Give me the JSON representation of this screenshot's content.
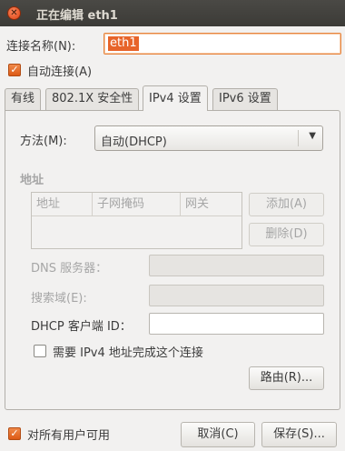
{
  "window": {
    "title": "正在编辑 eth1",
    "close_glyph": "✕"
  },
  "connection_name": {
    "label": "连接名称(N):",
    "value": "eth1"
  },
  "auto_connect": {
    "label": "自动连接(A)",
    "checked": true
  },
  "tabs": [
    {
      "label": "有线",
      "active": false
    },
    {
      "label": "802.1X 安全性",
      "active": false
    },
    {
      "label": "IPv4 设置",
      "active": true
    },
    {
      "label": "IPv6 设置",
      "active": false
    }
  ],
  "ipv4": {
    "method_label": "方法(M):",
    "method_value": "自动(DHCP)",
    "address_section": "地址",
    "table_headers": [
      "地址",
      "子网掩码",
      "网关"
    ],
    "add_button": "添加(A)",
    "delete_button": "删除(D)",
    "dns_label": "DNS 服务器：",
    "search_domains_label": "搜索域(E):",
    "dhcp_client_id_label": "DHCP 客户端 ID：",
    "require_ipv4_label": "需要 IPv4 地址完成这个连接",
    "require_ipv4_checked": false,
    "routes_button": "路由(R)..."
  },
  "footer": {
    "available_all_users_label": "对所有用户可用",
    "available_all_users_checked": true,
    "cancel_button": "取消(C)",
    "save_button": "保存(S)..."
  },
  "colors": {
    "accent": "#e7642a",
    "titlebar": "#3c3b37",
    "background": "#f2f1f0"
  }
}
